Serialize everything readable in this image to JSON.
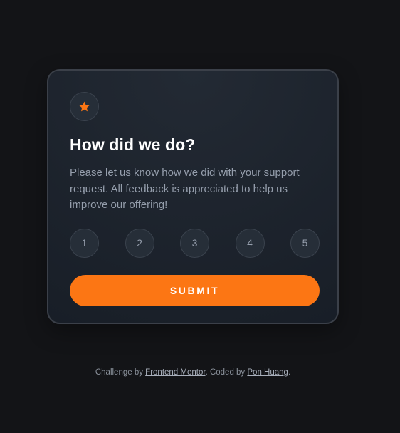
{
  "colors": {
    "background": "#131417",
    "card": "#1f252e",
    "accent": "#fc7614",
    "muted_text": "#959eac",
    "circle_bg": "#262e38"
  },
  "card": {
    "icon": "star-icon",
    "title": "How did we do?",
    "description": "Please let us know how we did with your support request. All feedback is appreciated to help us improve our offering!",
    "ratings": [
      "1",
      "2",
      "3",
      "4",
      "5"
    ],
    "submit_label": "SUBMIT"
  },
  "attribution": {
    "prefix": "Challenge by ",
    "link1": "Frontend Mentor",
    "middle": ". Coded by ",
    "link2": "Pon Huang",
    "suffix": "."
  }
}
